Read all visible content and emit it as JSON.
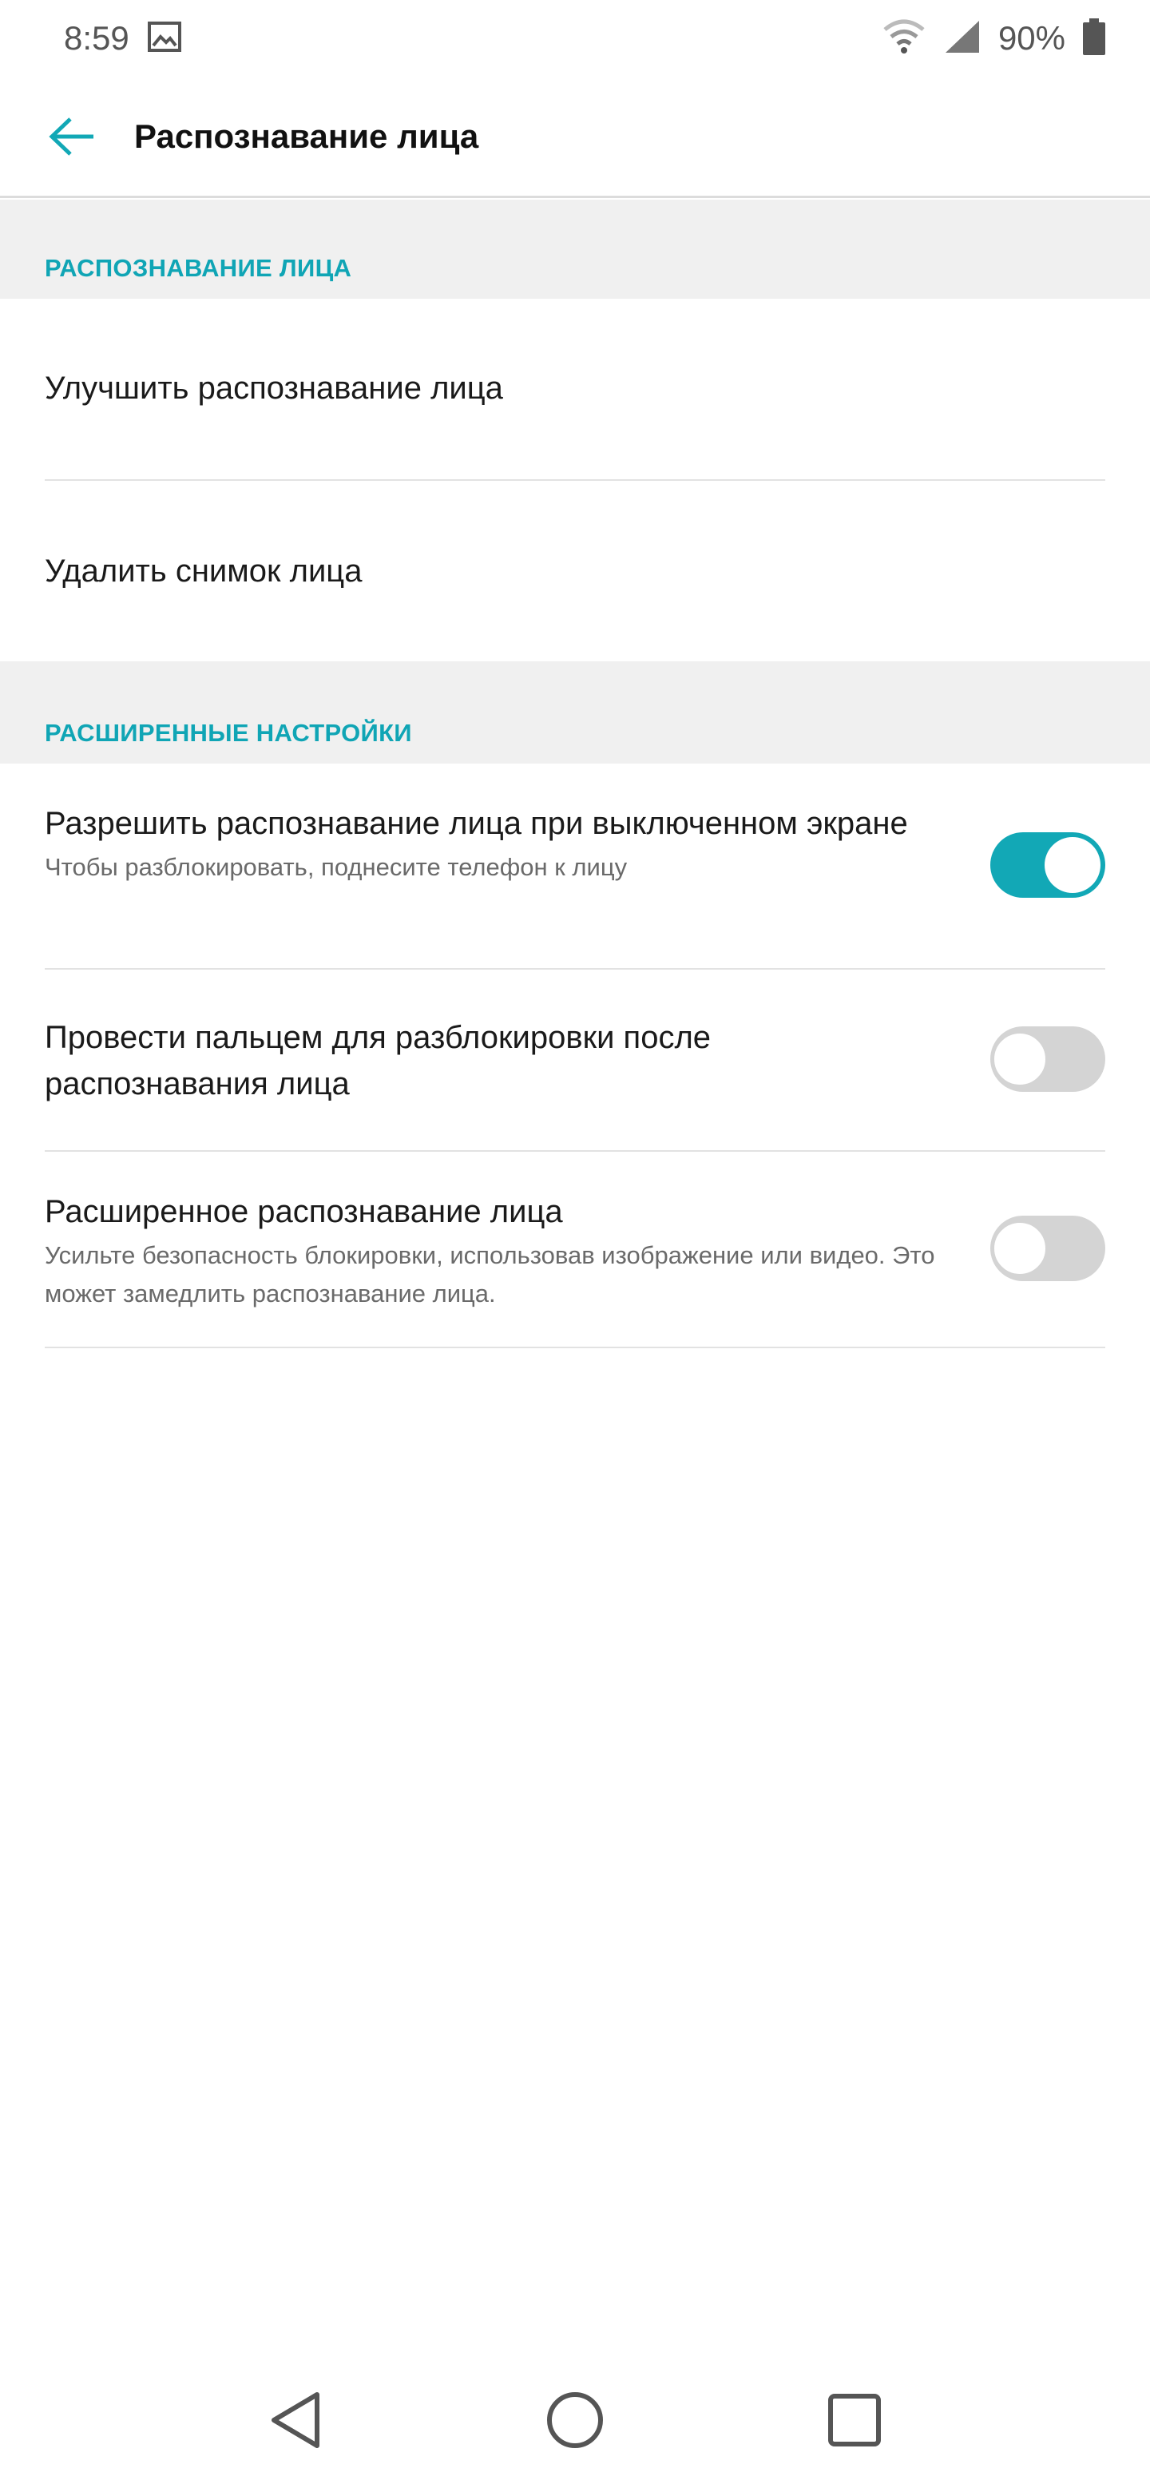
{
  "status_bar": {
    "time": "8:59",
    "battery_percent": "90%",
    "icons": [
      "image-icon",
      "wifi-icon",
      "signal-icon",
      "battery-icon"
    ]
  },
  "app_bar": {
    "title": "Распознавание лица",
    "back_icon": "back-arrow-icon"
  },
  "sections": [
    {
      "header": "РАСПОЗНАВАНИЕ ЛИЦА",
      "items": [
        {
          "title": "Улучшить распознавание лица"
        },
        {
          "title": "Удалить снимок лица"
        }
      ]
    },
    {
      "header": "РАСШИРЕННЫЕ НАСТРОЙКИ",
      "items": [
        {
          "title": "Разрешить распознавание лица при выключенном экране",
          "subtitle": "Чтобы разблокировать, поднесите телефон к лицу",
          "toggle_on": true
        },
        {
          "title": "Провести пальцем для разблокировки после распознавания лица",
          "toggle_on": false
        },
        {
          "title": "Расширенное распознавание лица",
          "subtitle": "Усильте безопасность блокировки, использовав изображение или видео. Это может замедлить распознавание лица.",
          "toggle_on": false
        }
      ]
    }
  ],
  "colors": {
    "accent": "#12a8b6",
    "section_bg": "#f0f0f0",
    "toggle_off": "#d4d4d4"
  },
  "nav_bar": {
    "icons": [
      "back-triangle-icon",
      "home-circle-icon",
      "recents-square-icon"
    ]
  }
}
